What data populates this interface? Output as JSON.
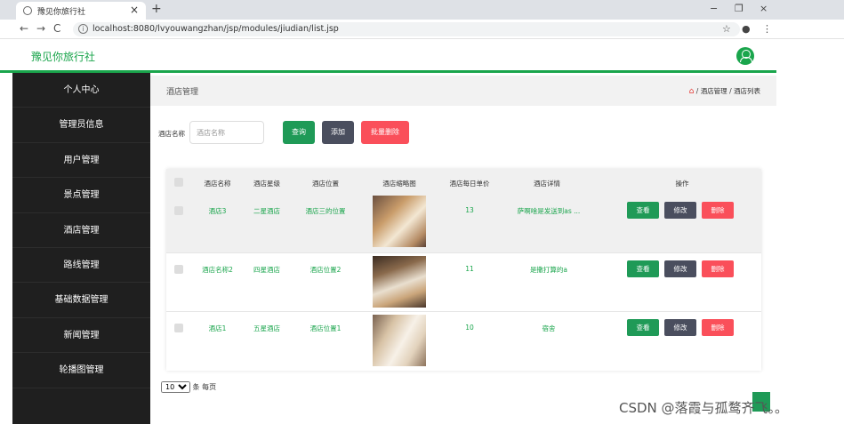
{
  "browser": {
    "tab_title": "豫见你旅行社",
    "tab_close": "×",
    "new_tab": "+",
    "url": "localhost:8080/lvyouwangzhan/jsp/modules/jiudian/list.jsp",
    "win_minimize": "−",
    "win_restore": "❐",
    "win_close": "×",
    "nav_back": "←",
    "nav_forward": "→",
    "nav_reload": "C",
    "star": "☆",
    "profile": "●",
    "menu": "⋮"
  },
  "app": {
    "brand": "豫见你旅行社"
  },
  "sidebar": {
    "items": [
      {
        "label": "个人中心"
      },
      {
        "label": "管理员信息"
      },
      {
        "label": "用户管理"
      },
      {
        "label": "景点管理"
      },
      {
        "label": "酒店管理"
      },
      {
        "label": "路线管理"
      },
      {
        "label": "基础数据管理"
      },
      {
        "label": "新闻管理"
      },
      {
        "label": "轮播图管理"
      }
    ]
  },
  "breadcrumb": {
    "title": "酒店管理",
    "home_icon": "⌂",
    "sep": "/",
    "level1": "酒店管理",
    "level2": "酒店列表"
  },
  "search": {
    "label": "酒店名称",
    "placeholder": "酒店名称",
    "query_button": "查询",
    "add_button": "添加",
    "batch_delete_button": "批量删除"
  },
  "table": {
    "headers": [
      "酒店名称",
      "酒店星级",
      "酒店位置",
      "酒店缩略图",
      "酒店每日单价",
      "酒店详情",
      "操作"
    ],
    "rows": [
      {
        "name": "酒店3",
        "star": "二星酒店",
        "location": "酒店三的位置",
        "price": "13",
        "detail": "萨啊啥是发送到as ...",
        "image": "room-1"
      },
      {
        "name": "酒店名称2",
        "star": "四星酒店",
        "location": "酒店位置2",
        "price": "11",
        "detail": "是撒打算的a",
        "image": "room-2"
      },
      {
        "name": "酒店1",
        "star": "五星酒店",
        "location": "酒店位置1",
        "price": "10",
        "detail": "宿舍",
        "image": "room-3"
      }
    ],
    "actions": {
      "view": "查看",
      "edit": "修改",
      "delete": "删除"
    }
  },
  "pagination": {
    "page_size": "10",
    "suffix": "条 每页"
  },
  "watermark": "CSDN @落霞与孤鹜齐飞。。",
  "colors": {
    "accent": "#1aa54c",
    "sidebar_bg": "#1f1f1f",
    "danger": "#fa4f5a",
    "dark_button": "#4a4e5e"
  }
}
